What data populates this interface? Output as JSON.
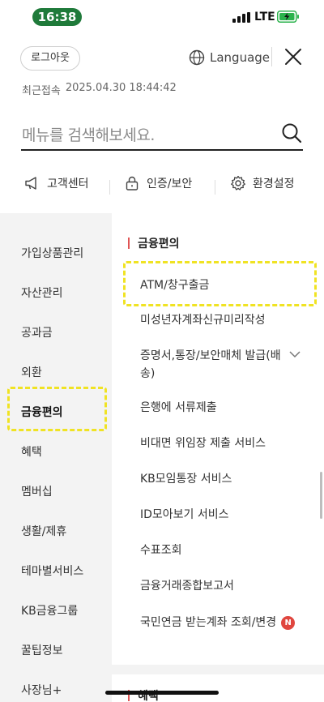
{
  "status_bar": {
    "time": "16:38",
    "network": "LTE"
  },
  "header": {
    "logout_label": "로그아웃",
    "language_label": "Language",
    "last_login_label": "최근접속",
    "last_login_value": "2025.04.30 18:44:42"
  },
  "search": {
    "placeholder": "메뉴를 검색해보세요."
  },
  "quick_links": [
    {
      "label": "고객센터",
      "icon": "megaphone-icon"
    },
    {
      "label": "인증/보안",
      "icon": "lock-icon"
    },
    {
      "label": "환경설정",
      "icon": "gear-icon"
    }
  ],
  "left_nav": {
    "items": [
      "가입상품관리",
      "자산관리",
      "공과금",
      "외환",
      "금융편의",
      "혜택",
      "멤버십",
      "생활/제휴",
      "테마별서비스",
      "KB금융그룹",
      "꿀팁정보",
      "사장님+"
    ],
    "active": "금융편의"
  },
  "right_menu": {
    "section_title": "금융편의",
    "items": [
      "ATM/창구출금",
      "미성년자계좌신규미리작성",
      "증명서,통장/보안매체 발급(배송)",
      "은행에 서류제출",
      "비대면 위임장 제출 서비스",
      "KB모임통장 서비스",
      "ID모아보기 서비스",
      "수표조회",
      "금융거래종합보고서",
      "국민연금 받는계좌 조회/변경"
    ],
    "new_badge": "N",
    "next_section_title": "혜택"
  },
  "colors": {
    "highlight": "#f0e323",
    "accent_red": "#e05555",
    "badge_red": "#e0463f",
    "time_pill": "#1f7a3a"
  }
}
